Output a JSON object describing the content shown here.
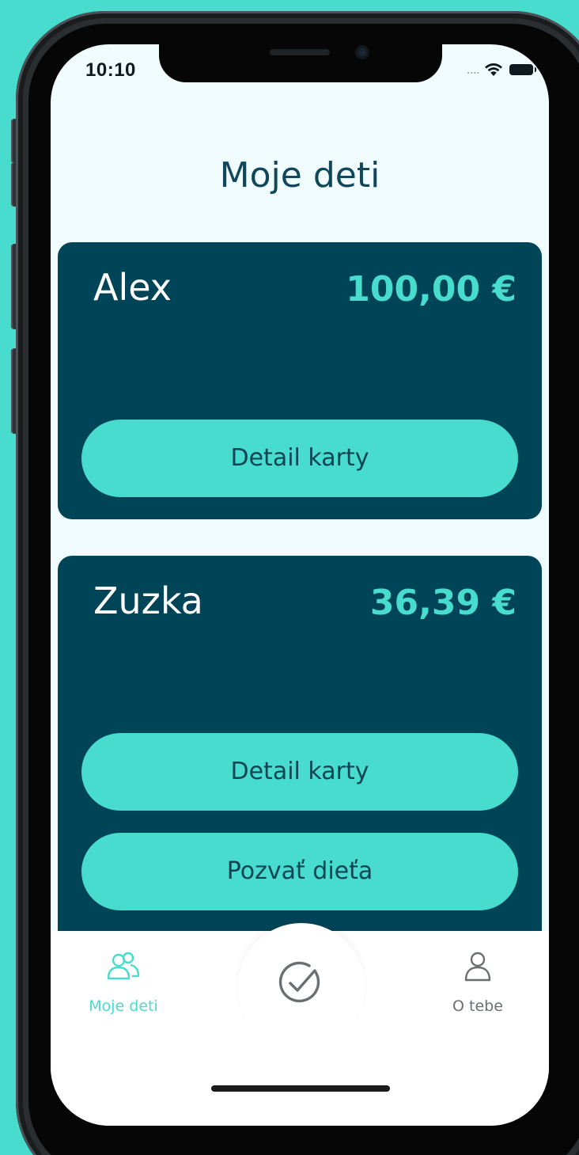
{
  "status_bar": {
    "time": "10:10",
    "signal_icon": "signal-dots-icon",
    "wifi_icon": "wifi-icon",
    "battery_icon": "battery-icon"
  },
  "page": {
    "title": "Moje deti"
  },
  "children": [
    {
      "name": "Alex",
      "balance": "100,00 €",
      "buttons": [
        "Detail karty"
      ]
    },
    {
      "name": "Zuzka",
      "balance": "36,39 €",
      "buttons": [
        "Detail karty",
        "Pozvať dieťa"
      ]
    }
  ],
  "tabbar": {
    "left": {
      "label": "Moje deti",
      "icon": "users-icon",
      "active": true
    },
    "center": {
      "icon": "check-circle-icon"
    },
    "right": {
      "label": "O tebe",
      "icon": "user-icon",
      "active": false
    }
  },
  "colors": {
    "background": "#47dccd",
    "card": "#004458",
    "accent": "#47dccd",
    "title": "#10475b",
    "screen": "#effbfc",
    "tab_active": "#47dccd",
    "tab_inactive": "#6b6f72"
  }
}
